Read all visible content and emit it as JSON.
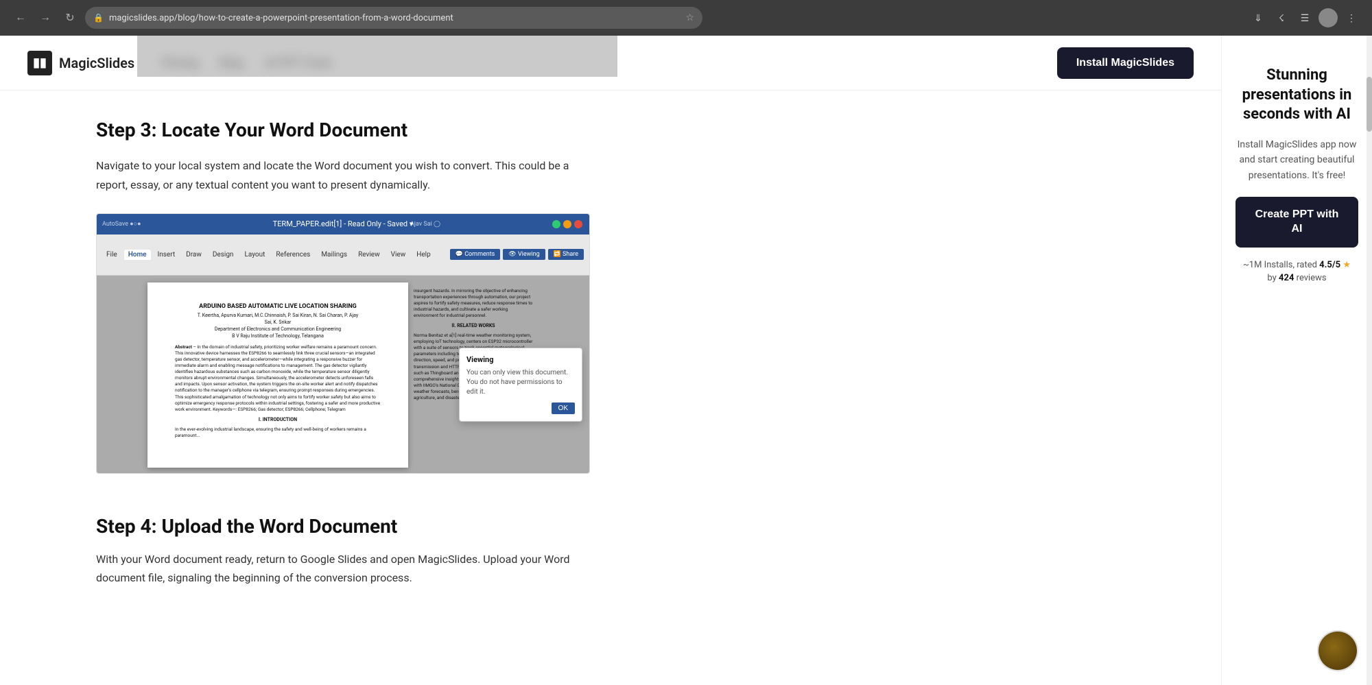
{
  "browser": {
    "url": "magicslides.app/blog/how-to-create-a-powerpoint-presentation-from-a-word-document",
    "back_tooltip": "Go back",
    "forward_tooltip": "Go forward",
    "refresh_tooltip": "Reload page"
  },
  "header": {
    "logo_text": "MagicSlides",
    "nav": [
      {
        "label": "Pricing",
        "href": "#"
      },
      {
        "label": "Blog",
        "href": "#"
      },
      {
        "label": "AI PPT Tools",
        "href": "#"
      }
    ],
    "install_button": "Install MagicSlides"
  },
  "article": {
    "step3": {
      "heading": "Step 3: Locate Your Word Document",
      "description": "Navigate to your local system and locate the Word document you wish to convert. This could be a report, essay, or any textual content you want to present dynamically."
    },
    "word_doc": {
      "title": "ARDUINO BASED AUTOMATIC LIVE LOCATION SHARING",
      "subtitle1": "T. Keertha, Apurva Kumari, M.C.Chinnaish, P. Sai Kiran, N. Sai Charan, P. Ajay",
      "subtitle2": "Sai, K. Srikar",
      "subtitle3": "Department of Electronics and Communication Engineering",
      "subtitle4": "B V Raju Institute of Technology, Telangana",
      "abstract_label": "Abstract",
      "related_works": "II. RELATED WORKS",
      "intro": "I. INTRODUCTION"
    },
    "viewing_popup": {
      "title": "Viewing",
      "body": "You can only view this document. You do not have permissions to edit it.",
      "ok_button": "OK"
    },
    "step4": {
      "heading": "Step 4: Upload the Word Document",
      "description": "With your Word document ready, return to Google Slides and open MagicSlides. Upload your Word document file, signaling the beginning of the conversion process."
    }
  },
  "sidebar": {
    "heading": "Stunning presentations in seconds with AI",
    "description": "Install MagicSlides app now and start creating beautiful presentations. It's free!",
    "create_button": "Create PPT with AI",
    "rating_installs": "~1M Installs, rated",
    "rating_value": "4.5/5",
    "rating_reviews_prefix": "by",
    "rating_count": "424",
    "rating_reviews_suffix": "reviews"
  }
}
